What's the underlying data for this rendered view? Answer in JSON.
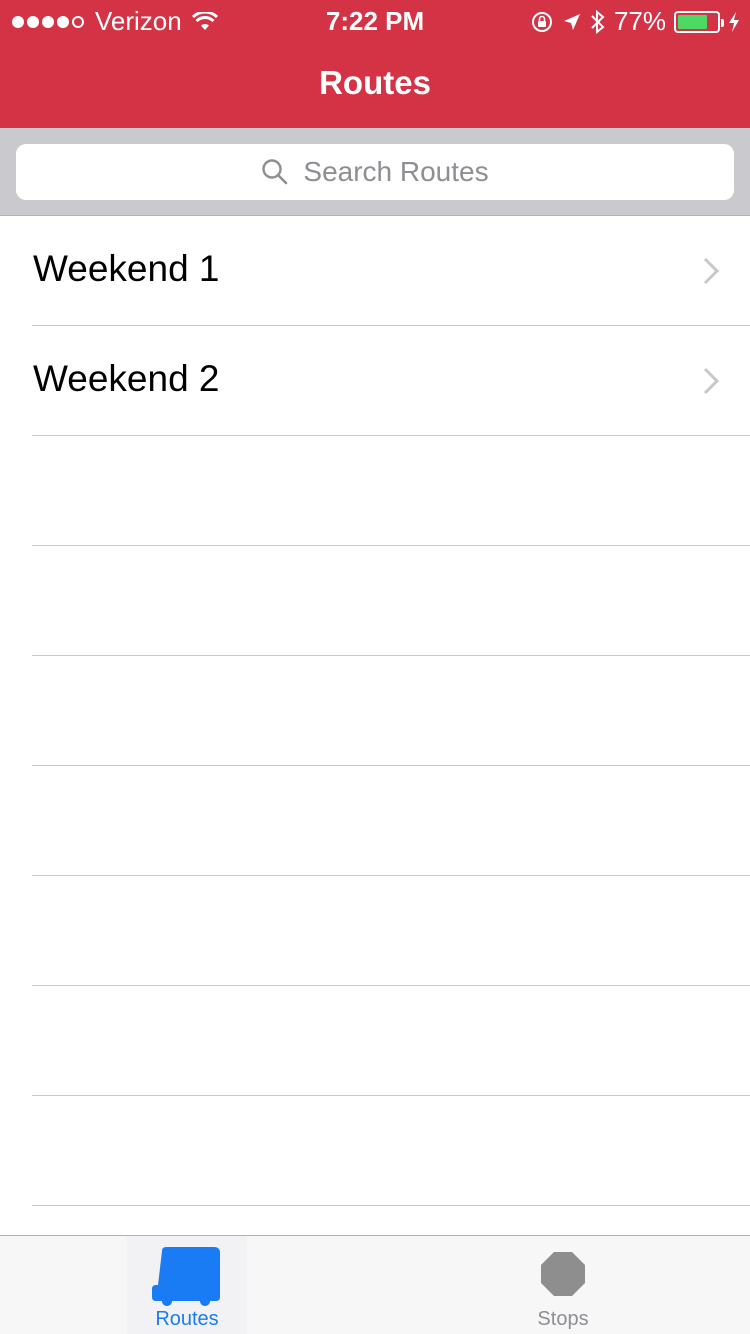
{
  "status_bar": {
    "carrier": "Verizon",
    "time": "7:22 PM",
    "battery": "77%",
    "battery_level": 0.77,
    "icons": [
      "signal-dots-icon",
      "wifi-icon",
      "orientation-lock-icon",
      "location-arrow-icon",
      "bluetooth-icon",
      "battery-icon",
      "charging-bolt-icon"
    ]
  },
  "nav": {
    "title": "Routes"
  },
  "search": {
    "placeholder": "Search Routes"
  },
  "routes": [
    {
      "label": "Weekend 1"
    },
    {
      "label": "Weekend 2"
    }
  ],
  "tabs": [
    {
      "label": "Routes",
      "icon": "bus-icon",
      "selected": true
    },
    {
      "label": "Stops",
      "icon": "stop-sign-icon",
      "selected": false
    }
  ],
  "colors": {
    "header": "#d43346",
    "accent": "#1a7cf5",
    "battery_fill": "#4cd964"
  }
}
